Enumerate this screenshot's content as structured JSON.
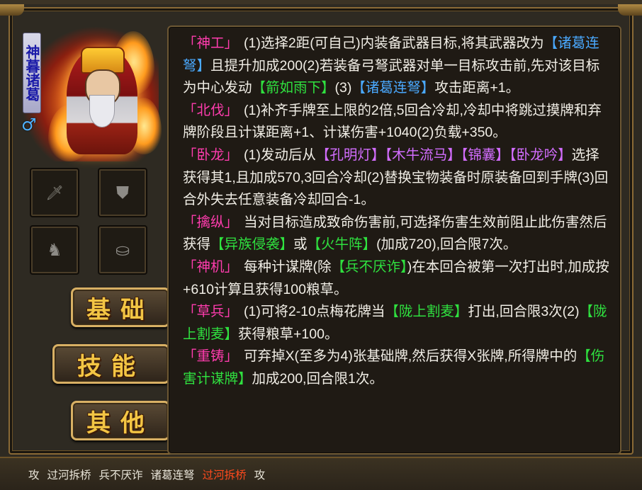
{
  "hero": {
    "name": "神暮诸葛",
    "gender_icon": "male-symbol",
    "gender_glyph": "♂"
  },
  "equipment_slots": [
    {
      "slot": "weapon",
      "icon": "sword-icon",
      "glyph": "🗡"
    },
    {
      "slot": "armor",
      "icon": "shield-icon",
      "glyph": "⛊"
    },
    {
      "slot": "horse",
      "icon": "horse-icon",
      "glyph": "♞"
    },
    {
      "slot": "treasure",
      "icon": "treasure-chest-icon",
      "glyph": "⛀"
    }
  ],
  "side_tabs": {
    "basic": "基础",
    "skills": "技能",
    "other": "其他"
  },
  "skills": [
    {
      "name": "「神工」",
      "parts": [
        {
          "t": "(1)选择2距(可自己)内装备武器目标,将其武器改为"
        },
        {
          "t": "【诸葛连弩】",
          "c": "b"
        },
        {
          "t": "且提升加成200(2)若装备弓弩武器对单一目标攻击前,先对该目标为中心发动"
        },
        {
          "t": "【箭如雨下】",
          "c": "g"
        },
        {
          "t": "(3)"
        },
        {
          "t": "【诸葛连弩】",
          "c": "b"
        },
        {
          "t": "攻击距离+1。"
        }
      ]
    },
    {
      "name": "「北伐」",
      "parts": [
        {
          "t": "(1)补齐手牌至上限的2倍,5回合冷却,冷却中将跳过摸牌和弃牌阶段且计谋距离+1、计谋伤害+1040(2)负载+350。"
        }
      ]
    },
    {
      "name": "「卧龙」",
      "parts": [
        {
          "t": "(1)发动后从"
        },
        {
          "t": "【孔明灯】",
          "c": "p"
        },
        {
          "t": "【木牛流马】",
          "c": "p"
        },
        {
          "t": "【锦囊】",
          "c": "p"
        },
        {
          "t": "【卧龙吟】",
          "c": "p"
        },
        {
          "t": "选择获得其1,且加成570,3回合冷却(2)替换宝物装备时原装备回到手牌(3)回合外失去任意装备冷却回合-1。"
        }
      ]
    },
    {
      "name": "「擒纵」",
      "parts": [
        {
          "t": "当对目标造成致命伤害前,可选择伤害生效前阻止此伤害然后获得"
        },
        {
          "t": "【异族侵袭】",
          "c": "g"
        },
        {
          "t": "或"
        },
        {
          "t": "【火牛阵】",
          "c": "g"
        },
        {
          "t": "(加成720),回合限7次。"
        }
      ]
    },
    {
      "name": "「神机」",
      "parts": [
        {
          "t": "每种计谋牌(除"
        },
        {
          "t": "【兵不厌诈】",
          "c": "g"
        },
        {
          "t": ")在本回合被第一次打出时,加成按+610计算且获得100粮草。"
        }
      ]
    },
    {
      "name": "「草兵」",
      "parts": [
        {
          "t": "(1)可将2-10点梅花牌当"
        },
        {
          "t": "【陇上割麦】",
          "c": "g"
        },
        {
          "t": "打出,回合限3次(2)"
        },
        {
          "t": "【陇上割麦】",
          "c": "g"
        },
        {
          "t": "获得粮草+100。"
        }
      ]
    },
    {
      "name": "「重铸」",
      "parts": [
        {
          "t": "可弃掉X(至多为4)张基础牌,然后获得X张牌,所得牌中的"
        },
        {
          "t": "【伤害计谋牌】",
          "c": "g"
        },
        {
          "t": "加成200,回合限1次。"
        }
      ]
    }
  ],
  "status_bar": [
    {
      "text": "攻",
      "highlight": false
    },
    {
      "text": "过河拆桥",
      "highlight": false
    },
    {
      "text": "兵不厌诈",
      "highlight": false
    },
    {
      "text": "诸葛连弩",
      "highlight": false
    },
    {
      "text": "过河拆桥",
      "highlight": true
    },
    {
      "text": "攻",
      "highlight": false
    }
  ],
  "colors": {
    "skill_name": "#ff3cae",
    "card_blue": "#4aa9ff",
    "card_green": "#2fe03f",
    "card_purple": "#d36dff",
    "status_highlight": "#ff4a1d"
  }
}
